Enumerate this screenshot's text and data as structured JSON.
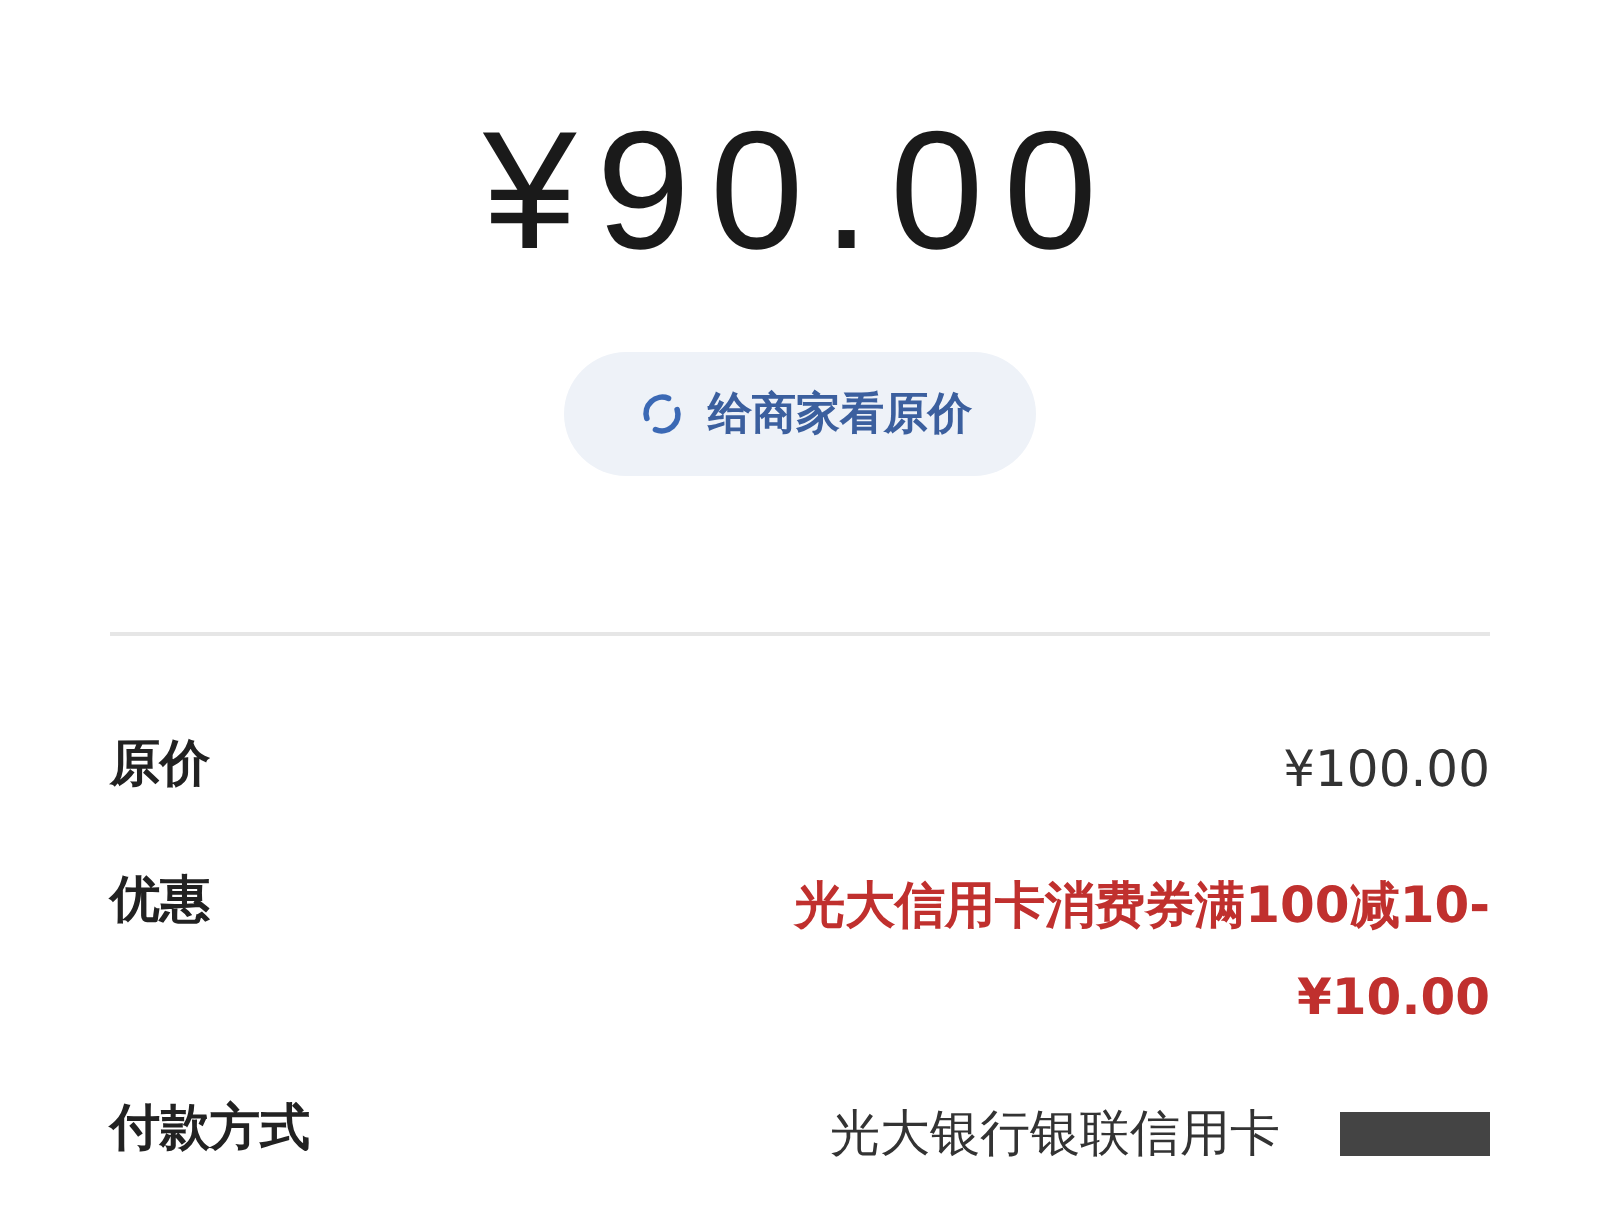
{
  "amount": "¥90.00",
  "view_original_button": {
    "label": "给商家看原价"
  },
  "details": [
    {
      "label": "原价",
      "value": "¥100.00",
      "kind": "normal"
    },
    {
      "label": "优惠",
      "value": "光大信用卡消费券满100减10-¥10.00",
      "kind": "discount"
    },
    {
      "label": "付款方式",
      "value": "光大银行银联信用卡",
      "kind": "payment"
    }
  ]
}
